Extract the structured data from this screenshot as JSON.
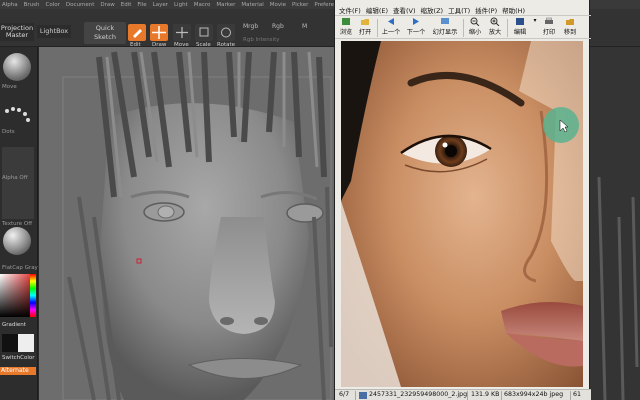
{
  "zbrush": {
    "menu": [
      "Alpha",
      "Brush",
      "Color",
      "Document",
      "Draw",
      "Edit",
      "File",
      "Layer",
      "Light",
      "Macro",
      "Marker",
      "Material",
      "Movie",
      "Picker",
      "Preferences"
    ],
    "shelf": {
      "projection_master": "Projection Master",
      "lightbox": "LightBox",
      "quick_sketch": "Quick Sketch",
      "edit": "Edit",
      "draw": "Draw",
      "move": "Move",
      "scale": "Scale",
      "rotate": "Rotate",
      "mrgb": "Mrgb",
      "rgb": "Rgb",
      "m": "M",
      "rgb_intensity": "Rgb Intensity"
    },
    "left": {
      "move": "Move",
      "dots": "Dots",
      "alpha_off": "Alpha Off",
      "texture_off": "Texture Off",
      "flat_cap": "FlatCap Gray",
      "gradient": "Gradient",
      "switch_color": "SwitchColor",
      "alternate": "Alternate"
    },
    "accent_color": "#e8782a"
  },
  "viewer": {
    "menu": [
      "文件(F)",
      "编辑(E)",
      "查看(V)",
      "缩放(Z)",
      "工具(T)",
      "插件(P)",
      "帮助(H)"
    ],
    "toolbar": [
      "浏览",
      "打开",
      "上一个",
      "下一个",
      "幻灯显示",
      "缩小",
      "放大",
      "编辑",
      "打印",
      "移到"
    ],
    "status": {
      "index": "6/7",
      "filename": "2457331_232959498000_2.jpg",
      "size": "131.9 KB",
      "dimensions": "683x994x24b jpeg",
      "zoom": "61"
    }
  }
}
